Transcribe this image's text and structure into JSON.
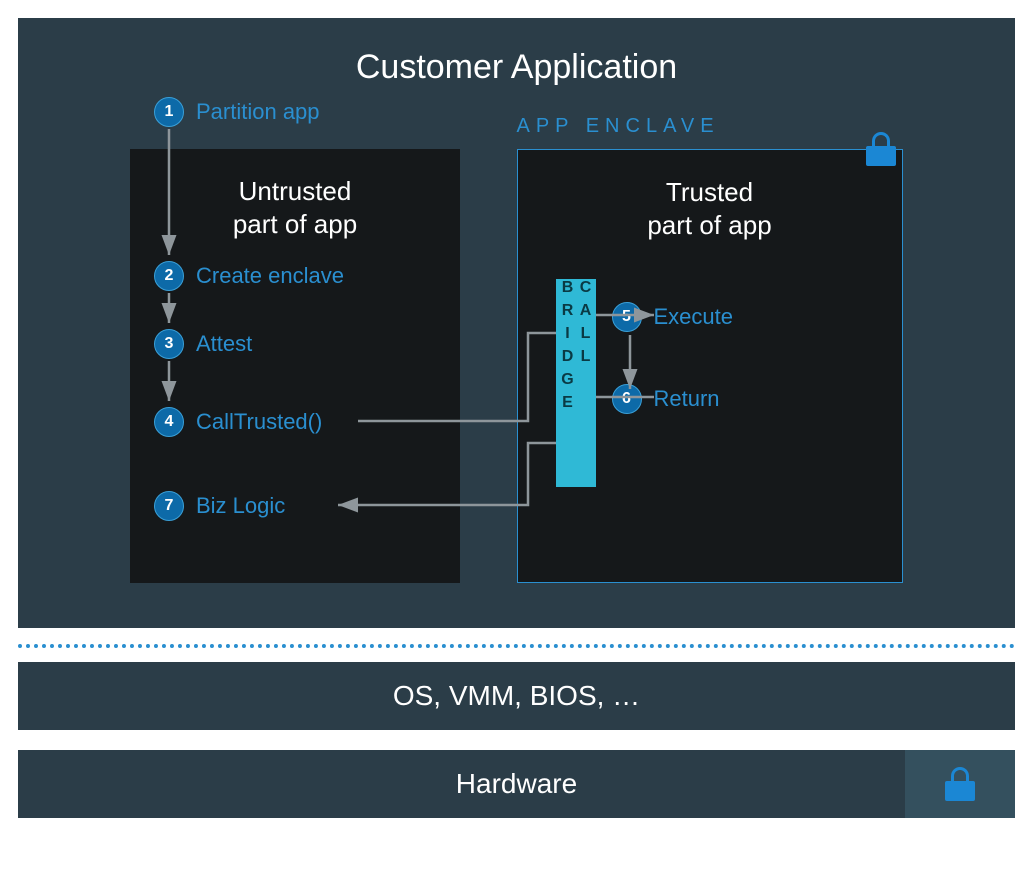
{
  "title": "Customer Application",
  "enclave_label": "APP ENCLAVE",
  "bridge_label": "CALL BRIDGE",
  "untrusted_title_line1": "Untrusted",
  "untrusted_title_line2": "part of app",
  "trusted_title_line1": "Trusted",
  "trusted_title_line2": "part of app",
  "steps": {
    "s1": {
      "n": "1",
      "label": "Partition app"
    },
    "s2": {
      "n": "2",
      "label": "Create enclave"
    },
    "s3": {
      "n": "3",
      "label": "Attest"
    },
    "s4": {
      "n": "4",
      "label": "CallTrusted()"
    },
    "s5": {
      "n": "5",
      "label": "Execute"
    },
    "s6": {
      "n": "6",
      "label": "Return"
    },
    "s7": {
      "n": "7",
      "label": "Biz Logic"
    }
  },
  "os_bar": "OS, VMM, BIOS, …",
  "hw_bar": "Hardware",
  "colors": {
    "panel": "#2b3d48",
    "box": "#15181a",
    "accent_blue": "#2a8fd0",
    "badge": "#0d6aa8",
    "bridge": "#2fb9d6",
    "lock": "#1b87d4"
  }
}
